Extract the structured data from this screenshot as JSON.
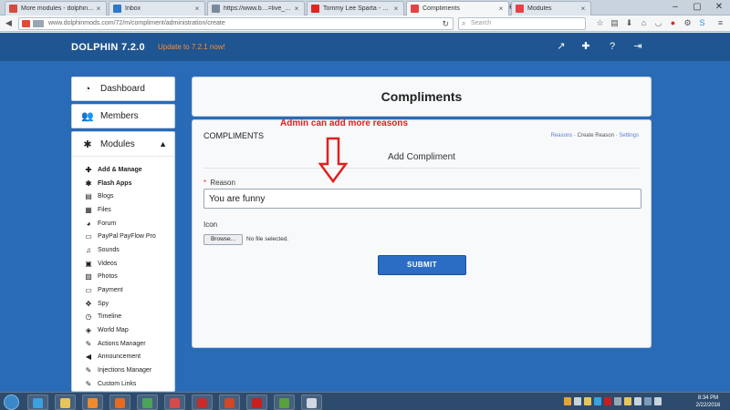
{
  "browser": {
    "tabs": [
      {
        "title": "More modules - dolphinm…",
        "color": "#d54b3d"
      },
      {
        "title": "Inbox",
        "color": "#2c79c8"
      },
      {
        "title": "https://www.b…=live_tracker",
        "color": "#7a8a9a"
      },
      {
        "title": "Tommy Lee Sparta - Mania…",
        "color": "#e0261f"
      },
      {
        "title": "Compliments",
        "color": "#e54343"
      },
      {
        "title": "Modules",
        "color": "#e54343"
      }
    ],
    "active_tab": 4,
    "url": "www.dolphinmods.com/72/m/compliment/administration/create",
    "search_placeholder": "Search"
  },
  "site": {
    "brand": "DOLPHIN 7.2.0",
    "update_text": "Update to 7.2.1 now!",
    "header_icons": [
      "external-link-icon",
      "puzzle-icon",
      "help-icon",
      "logout-icon"
    ],
    "colors": {
      "header": "#1f5590",
      "page": "#2a6bb8",
      "accent": "#ff8c33",
      "submit": "#2b6cc4"
    }
  },
  "sidebar": {
    "dashboard": "Dashboard",
    "members": "Members",
    "modules": "Modules",
    "items": [
      {
        "label": "Add & Manage",
        "icon": "plus-icon",
        "glyph": "✚",
        "bold": true
      },
      {
        "label": "Flash Apps",
        "icon": "puzzle-icon",
        "glyph": "✱",
        "bold": true
      },
      {
        "label": "Blogs",
        "icon": "book-icon",
        "glyph": "▤",
        "bold": false
      },
      {
        "label": "Files",
        "icon": "file-icon",
        "glyph": "▦",
        "bold": false
      },
      {
        "label": "Forum",
        "icon": "comments-icon",
        "glyph": "◕",
        "bold": false
      },
      {
        "label": "PayPal PayFlow Pro",
        "icon": "card-icon",
        "glyph": "▭",
        "bold": false
      },
      {
        "label": "Sounds",
        "icon": "music-icon",
        "glyph": "♫",
        "bold": false
      },
      {
        "label": "Videos",
        "icon": "film-icon",
        "glyph": "▣",
        "bold": false
      },
      {
        "label": "Photos",
        "icon": "picture-icon",
        "glyph": "▨",
        "bold": false
      },
      {
        "label": "Payment",
        "icon": "card-icon",
        "glyph": "▭",
        "bold": false
      },
      {
        "label": "Spy",
        "icon": "crosshair-icon",
        "glyph": "✥",
        "bold": false
      },
      {
        "label": "Timeline",
        "icon": "clock-icon",
        "glyph": "◷",
        "bold": false
      },
      {
        "label": "World Map",
        "icon": "map-icon",
        "glyph": "◈",
        "bold": false
      },
      {
        "label": "Actions Manager",
        "icon": "wrench-icon",
        "glyph": "✎",
        "bold": false
      },
      {
        "label": "Announcement",
        "icon": "bullhorn-icon",
        "glyph": "◀",
        "bold": false
      },
      {
        "label": "Injections Manager",
        "icon": "wrench-icon",
        "glyph": "✎",
        "bold": false
      },
      {
        "label": "Custom Links",
        "icon": "wrench-icon",
        "glyph": "✎",
        "bold": false
      }
    ]
  },
  "main": {
    "page_title": "Compliments",
    "section_label": "COMPLIMENTS",
    "crumbs": {
      "reasons": "Reasons",
      "create": "Create Reason",
      "settings": "Settings",
      "sep": "·"
    },
    "form_heading": "Add Compliment",
    "reason_label": "Reason",
    "required_mark": "*",
    "reason_value": "You are funny",
    "icon_label": "Icon",
    "browse_label": "Browse...",
    "no_file": "No file selected.",
    "submit_label": "SUBMIT"
  },
  "annotation": {
    "text": "Admin can add more reasons",
    "color": "#e02020"
  },
  "taskbar": {
    "apps": [
      {
        "name": "ie",
        "color": "#3aa0e0"
      },
      {
        "name": "explorer",
        "color": "#e8c45a"
      },
      {
        "name": "media-player",
        "color": "#f08a2c"
      },
      {
        "name": "firefox",
        "color": "#e86a1d"
      },
      {
        "name": "chrome",
        "color": "#4aa45a"
      },
      {
        "name": "paint",
        "color": "#d84a4a"
      },
      {
        "name": "filezilla",
        "color": "#c92b2b"
      },
      {
        "name": "powerpoint",
        "color": "#d24726"
      },
      {
        "name": "acrobat",
        "color": "#c81e1e"
      },
      {
        "name": "frog-app",
        "color": "#5aa03c"
      },
      {
        "name": "notepad",
        "color": "#cfd8e3"
      }
    ],
    "time": "8:34 PM",
    "date": "2/22/2016"
  }
}
